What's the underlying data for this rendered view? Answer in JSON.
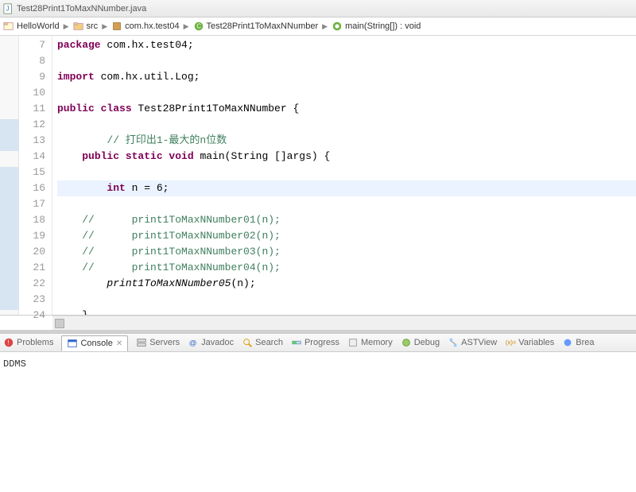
{
  "tabTitle": "Test28Print1ToMaxNNumber.java",
  "breadcrumbs": [
    {
      "label": "HelloWorld",
      "icon": "project"
    },
    {
      "label": "src",
      "icon": "folder"
    },
    {
      "label": "com.hx.test04",
      "icon": "package"
    },
    {
      "label": "Test28Print1ToMaxNNumber",
      "icon": "class"
    },
    {
      "label": "main(String[]) : void",
      "icon": "method"
    }
  ],
  "lines": [
    {
      "n": 7,
      "type": "code",
      "segs": [
        {
          "t": "package",
          "c": "kw"
        },
        {
          "t": " com.hx.test04;",
          "c": "norm"
        }
      ]
    },
    {
      "n": 8,
      "type": "blank"
    },
    {
      "n": 9,
      "type": "code",
      "segs": [
        {
          "t": "import",
          "c": "kw"
        },
        {
          "t": " com.hx.util.Log;",
          "c": "norm"
        }
      ]
    },
    {
      "n": 10,
      "type": "blank"
    },
    {
      "n": 11,
      "type": "code",
      "segs": [
        {
          "t": "public class",
          "c": "kw"
        },
        {
          "t": " Test28Print1ToMaxNNumber {",
          "c": "norm"
        }
      ]
    },
    {
      "n": 12,
      "type": "blank"
    },
    {
      "n": 13,
      "type": "code",
      "indent": 2,
      "segs": [
        {
          "t": "// 打印出1-最大的n位数",
          "c": "cm"
        }
      ]
    },
    {
      "n": 14,
      "type": "code",
      "indent": 1,
      "segs": [
        {
          "t": "public static void",
          "c": "kw"
        },
        {
          "t": " main(String []args) {",
          "c": "norm"
        }
      ],
      "marker": true
    },
    {
      "n": 15,
      "type": "blank"
    },
    {
      "n": 16,
      "type": "code",
      "indent": 2,
      "hl": true,
      "segs": [
        {
          "t": "int",
          "c": "kw"
        },
        {
          "t": " n = 6;",
          "c": "norm"
        }
      ]
    },
    {
      "n": 17,
      "type": "blank"
    },
    {
      "n": 18,
      "type": "code",
      "indent": 1,
      "segs": [
        {
          "t": "//      print1ToMaxNNumber01(n);",
          "c": "cm"
        }
      ]
    },
    {
      "n": 19,
      "type": "code",
      "indent": 1,
      "segs": [
        {
          "t": "//      print1ToMaxNNumber02(n);",
          "c": "cm"
        }
      ]
    },
    {
      "n": 20,
      "type": "code",
      "indent": 1,
      "segs": [
        {
          "t": "//      print1ToMaxNNumber03(n);",
          "c": "cm"
        }
      ]
    },
    {
      "n": 21,
      "type": "code",
      "indent": 1,
      "segs": [
        {
          "t": "//      print1ToMaxNNumber04(n);",
          "c": "cm"
        }
      ]
    },
    {
      "n": 22,
      "type": "code",
      "indent": 2,
      "segs": [
        {
          "t": "print1ToMaxNNumber05",
          "c": "call"
        },
        {
          "t": "(n);",
          "c": "norm"
        }
      ]
    },
    {
      "n": 23,
      "type": "blank"
    },
    {
      "n": 24,
      "type": "code",
      "indent": 1,
      "segs": [
        {
          "t": "}",
          "c": "norm"
        }
      ]
    }
  ],
  "views": [
    {
      "label": "Problems",
      "active": false,
      "icon": "problems"
    },
    {
      "label": "Console",
      "active": true,
      "icon": "console"
    },
    {
      "label": "Servers",
      "active": false,
      "icon": "servers"
    },
    {
      "label": "Javadoc",
      "active": false,
      "icon": "javadoc"
    },
    {
      "label": "Search",
      "active": false,
      "icon": "search"
    },
    {
      "label": "Progress",
      "active": false,
      "icon": "progress"
    },
    {
      "label": "Memory",
      "active": false,
      "icon": "memory"
    },
    {
      "label": "Debug",
      "active": false,
      "icon": "debug"
    },
    {
      "label": "ASTView",
      "active": false,
      "icon": "ast"
    },
    {
      "label": "Variables",
      "active": false,
      "icon": "vars"
    },
    {
      "label": "Brea",
      "active": false,
      "icon": "break"
    }
  ],
  "consoleText": "DDMS"
}
